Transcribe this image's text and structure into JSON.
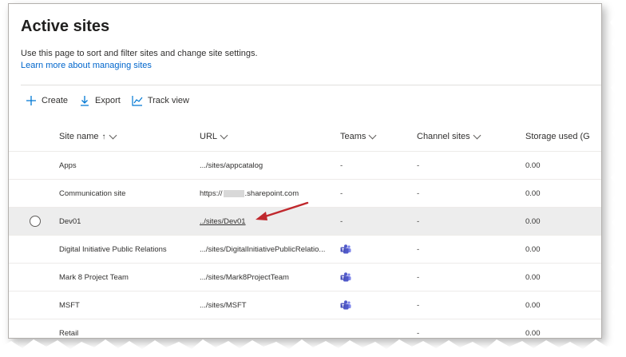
{
  "page": {
    "title": "Active sites",
    "description": "Use this page to sort and filter sites and change site settings.",
    "learn_more": "Learn more about managing sites"
  },
  "commands": {
    "create": "Create",
    "export": "Export",
    "track_view": "Track view"
  },
  "columns": {
    "site_name": "Site name",
    "site_name_sort": "↑",
    "url": "URL",
    "teams": "Teams",
    "channel_sites": "Channel sites",
    "storage_used": "Storage used (G"
  },
  "rows": [
    {
      "name": "Apps",
      "url": ".../sites/appcatalog",
      "teams": "-",
      "channel_sites": "-",
      "storage": "0.00"
    },
    {
      "name": "Communication site",
      "url_prefix": "https://",
      "url_suffix": ".sharepoint.com",
      "teams": "-",
      "channel_sites": "-",
      "storage": "0.00"
    },
    {
      "name": "Dev01",
      "url": "../sites/Dev01",
      "teams": "-",
      "channel_sites": "-",
      "storage": "0.00"
    },
    {
      "name": "Digital Initiative Public Relations",
      "url": ".../sites/DigitalInitiativePublicRelatio...",
      "teams_icon": "microsoft-teams-icon",
      "channel_sites": "-",
      "storage": "0.00"
    },
    {
      "name": "Mark 8 Project Team",
      "url": ".../sites/Mark8ProjectTeam",
      "teams_icon": "microsoft-teams-icon",
      "channel_sites": "-",
      "storage": "0.00"
    },
    {
      "name": "MSFT",
      "url": ".../sites/MSFT",
      "teams_icon": "microsoft-teams-icon",
      "channel_sites": "-",
      "storage": "0.00"
    },
    {
      "name": "Retail",
      "url": "",
      "teams": "",
      "channel_sites": "-",
      "storage": "0.00"
    }
  ],
  "colors": {
    "link": "#0066cc",
    "accent": "#0078d4",
    "selected_row": "#ededed",
    "annotation_arrow": "#c0282d",
    "teams_purple": "#5059c9"
  }
}
